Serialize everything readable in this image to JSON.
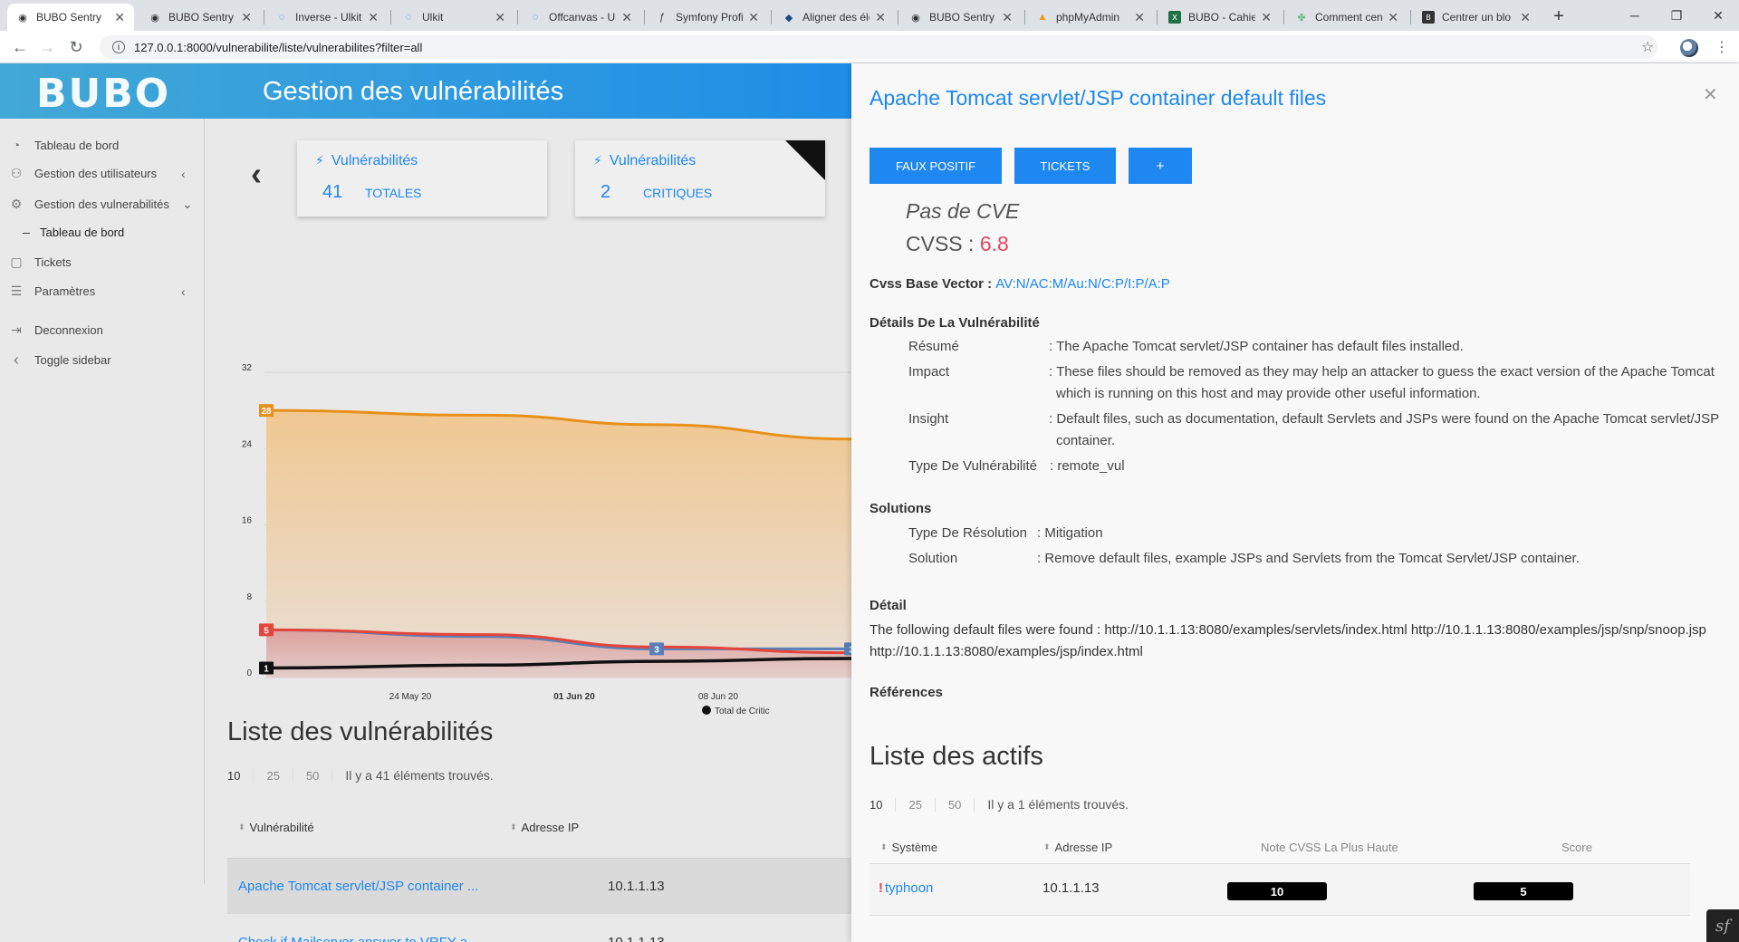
{
  "browser": {
    "tabs": [
      {
        "title": "BUBO Sentry",
        "icon": "github-icon"
      },
      {
        "title": "BUBO Sentry",
        "icon": "github-icon"
      },
      {
        "title": "Inverse - Ulkit",
        "icon": "uikit-icon"
      },
      {
        "title": "Ulkit",
        "icon": "uikit-icon"
      },
      {
        "title": "Offcanvas - Ul",
        "icon": "uikit-icon"
      },
      {
        "title": "Symfony Profi",
        "icon": "symfony-icon"
      },
      {
        "title": "Aligner des élé",
        "icon": "bookmark-icon"
      },
      {
        "title": "BUBO Sentry",
        "icon": "github-icon"
      },
      {
        "title": "phpMyAdmin",
        "icon": "phpmyadmin-icon"
      },
      {
        "title": "BUBO - Cahie",
        "icon": "excel-icon"
      },
      {
        "title": "Comment cen",
        "icon": "stackoverflow-icon"
      },
      {
        "title": "Centrer un blo",
        "icon": "dev-icon"
      }
    ],
    "url": "127.0.0.1:8000/vulnerabilite/liste/vulnerabilites?filter=all"
  },
  "app": {
    "logo": "BUBO",
    "page_title": "Gestion des vulnérabilités"
  },
  "sidebar": {
    "items": [
      {
        "label": "Tableau de bord",
        "icon": "dashboard-icon"
      },
      {
        "label": "Gestion des utilisateurs",
        "icon": "users-icon"
      },
      {
        "label": "Gestion des vulnerabilités",
        "icon": "gear-icon"
      },
      {
        "label": "Tableau de bord",
        "icon": "dash-icon"
      },
      {
        "label": "Tickets",
        "icon": "ticket-icon"
      },
      {
        "label": "Paramètres",
        "icon": "sliders-icon"
      },
      {
        "label": "Deconnexion",
        "icon": "logout-icon"
      },
      {
        "label": "Toggle sidebar",
        "icon": "chevron-left-icon"
      }
    ]
  },
  "cards": [
    {
      "title": "Vulnérabilités",
      "count": "41",
      "label": "TOTALES"
    },
    {
      "title": "Vulnérabilités",
      "count": "2",
      "label": "CRITIQUES"
    }
  ],
  "chart_data": {
    "type": "area",
    "y_ticks": [
      "32",
      "24",
      "16",
      "8",
      "0"
    ],
    "ylim": [
      0,
      32
    ],
    "x_ticks": [
      "24 May 20",
      "01 Jun 20",
      "08 Jun 20"
    ],
    "series": [
      {
        "name": "",
        "color": "#e8901c",
        "fill": "#f0c891",
        "values": [
          28,
          27.5,
          26.5,
          25
        ],
        "labels": [
          {
            "index": 0,
            "text": "28"
          }
        ]
      },
      {
        "name": "",
        "color": "#e2453c",
        "fill": "#e3b8b4",
        "values": [
          5,
          4.5,
          3.2,
          2.6
        ],
        "labels": [
          {
            "index": 0,
            "text": "5"
          }
        ]
      },
      {
        "name": "",
        "color": "#5b7fb5",
        "values": [
          5,
          4.3,
          3.0,
          3.0
        ],
        "labels": [
          {
            "index": 2,
            "text": "3"
          },
          {
            "index": 3,
            "text": "3"
          }
        ]
      },
      {
        "name": "Total de Critic",
        "color": "#111111",
        "values": [
          1,
          1.3,
          1.7,
          2
        ],
        "labels": [
          {
            "index": 0,
            "text": "1"
          }
        ]
      }
    ],
    "legend_text": "Total de Critic"
  },
  "vuln_list": {
    "title": "Liste des vulnérabilités",
    "page_sizes": [
      "10",
      "25",
      "50"
    ],
    "found_text": "Il y a 41 éléments trouvés.",
    "headers": {
      "name": "Vulnérabilité",
      "ip": "Adresse IP"
    },
    "rows": [
      {
        "name": "Apache Tomcat servlet/JSP container ...",
        "ip": "10.1.1.13"
      },
      {
        "name": "Check if Mailserver answer to VRFY a...",
        "ip": "10.1.1.13"
      }
    ]
  },
  "panel": {
    "title": "Apache Tomcat servlet/JSP container default files",
    "buttons": {
      "false_positive": "FAUX POSITIF",
      "tickets": "TICKETS",
      "plus": "+"
    },
    "cve": "Pas de CVE",
    "cvss_label": "CVSS :",
    "cvss_value": "6.8",
    "base_vector_label": "Cvss Base Vector :",
    "base_vector": "AV:N/AC:M/Au:N/C:P/I:P/A:P",
    "details_heading": "Détails De La Vulnérabilité",
    "details": [
      {
        "key": "Résumé",
        "value": ": The Apache Tomcat servlet/JSP container has default files installed."
      },
      {
        "key": "Impact",
        "value": ": These files should be removed as they may help an attacker to guess the exact version of the Apache Tomcat which is running on this host and may provide other useful information."
      },
      {
        "key": "Insight",
        "value": ": Default files, such as documentation, default Servlets and JSPs were found on the Apache Tomcat servlet/JSP container."
      },
      {
        "key": "Type De Vulnérabilité",
        "value": ": remote_vul"
      }
    ],
    "solutions_heading": "Solutions",
    "solutions": [
      {
        "key": "Type De Résolution",
        "value": ": Mitigation"
      },
      {
        "key": "Solution",
        "value": ": Remove default files, example JSPs and Servlets from the Tomcat Servlet/JSP container."
      }
    ],
    "detail_heading": "Détail",
    "detail_text": "The following default files were found : http://10.1.1.13:8080/examples/servlets/index.html http://10.1.1.13:8080/examples/jsp/snp/snoop.jsp http://10.1.1.13:8080/examples/jsp/index.html",
    "references_heading": "Références",
    "assets_title": "Liste des actifs",
    "asset_page_sizes": [
      "10",
      "25",
      "50"
    ],
    "assets_found": "Il y a 1 éléments trouvés.",
    "asset_headers": {
      "system": "Système",
      "ip": "Adresse IP",
      "cvss": "Note CVSS La Plus Haute",
      "score": "Score"
    },
    "assets": [
      {
        "marker": "!",
        "system": "typhoon",
        "ip": "10.1.1.13",
        "cvss": "10",
        "score": "5"
      }
    ]
  }
}
